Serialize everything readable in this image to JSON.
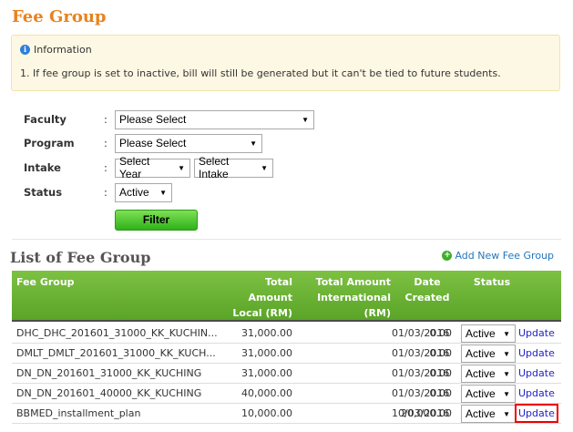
{
  "page": {
    "title": "Fee Group"
  },
  "info": {
    "title": "Information",
    "lines": [
      "1. If fee group is set to inactive, bill will still be generated but it can't be tied to future students."
    ]
  },
  "form": {
    "faculty": {
      "label": "Faculty",
      "value": "Please Select"
    },
    "program": {
      "label": "Program",
      "value": "Please Select"
    },
    "intake": {
      "label": "Intake",
      "year_value": "Select Year",
      "intake_value": "Select Intake"
    },
    "status": {
      "label": "Status",
      "value": "Active"
    },
    "colon": ":",
    "filter_label": "Filter"
  },
  "list": {
    "title": "List of Fee Group",
    "add_label": "Add New Fee Group",
    "columns": {
      "fee_group": "Fee Group",
      "local_1": "Total",
      "local_2": "Amount",
      "local_3": "Local (RM)",
      "intl_1": "Total Amount",
      "intl_2": "International",
      "intl_3": "(RM)",
      "date_1": "Date",
      "date_2": "Created",
      "status": "Status"
    },
    "rows": [
      {
        "name": "DHC_DHC_201601_31000_KK_KUCHIN...",
        "local": "31,000.00",
        "intl": "0.00",
        "date": "01/03/2016",
        "status": "Active",
        "action": "Update"
      },
      {
        "name": "DMLT_DMLT_201601_31000_KK_KUCH...",
        "local": "31,000.00",
        "intl": "0.00",
        "date": "01/03/2016",
        "status": "Active",
        "action": "Update"
      },
      {
        "name": "DN_DN_201601_31000_KK_KUCHING",
        "local": "31,000.00",
        "intl": "0.00",
        "date": "01/03/2016",
        "status": "Active",
        "action": "Update"
      },
      {
        "name": "DN_DN_201601_40000_KK_KUCHING",
        "local": "40,000.00",
        "intl": "0.00",
        "date": "01/03/2016",
        "status": "Active",
        "action": "Update"
      },
      {
        "name": "BBMED_installment_plan",
        "local": "10,000.00",
        "intl": "20,000.00",
        "date": "10/03/2016",
        "status": "Active",
        "action": "Update"
      }
    ]
  },
  "colors": {
    "title": "#e8821e",
    "header_green": "#6db535",
    "filter_green": "#2fb21a",
    "link_blue": "#2222cc",
    "highlight_red": "#ee0000",
    "info_bg": "#fdf8e4"
  },
  "icons": {
    "info": "info-circle-icon",
    "add": "plus-circle-icon",
    "dropdown": "caret-down-icon"
  }
}
